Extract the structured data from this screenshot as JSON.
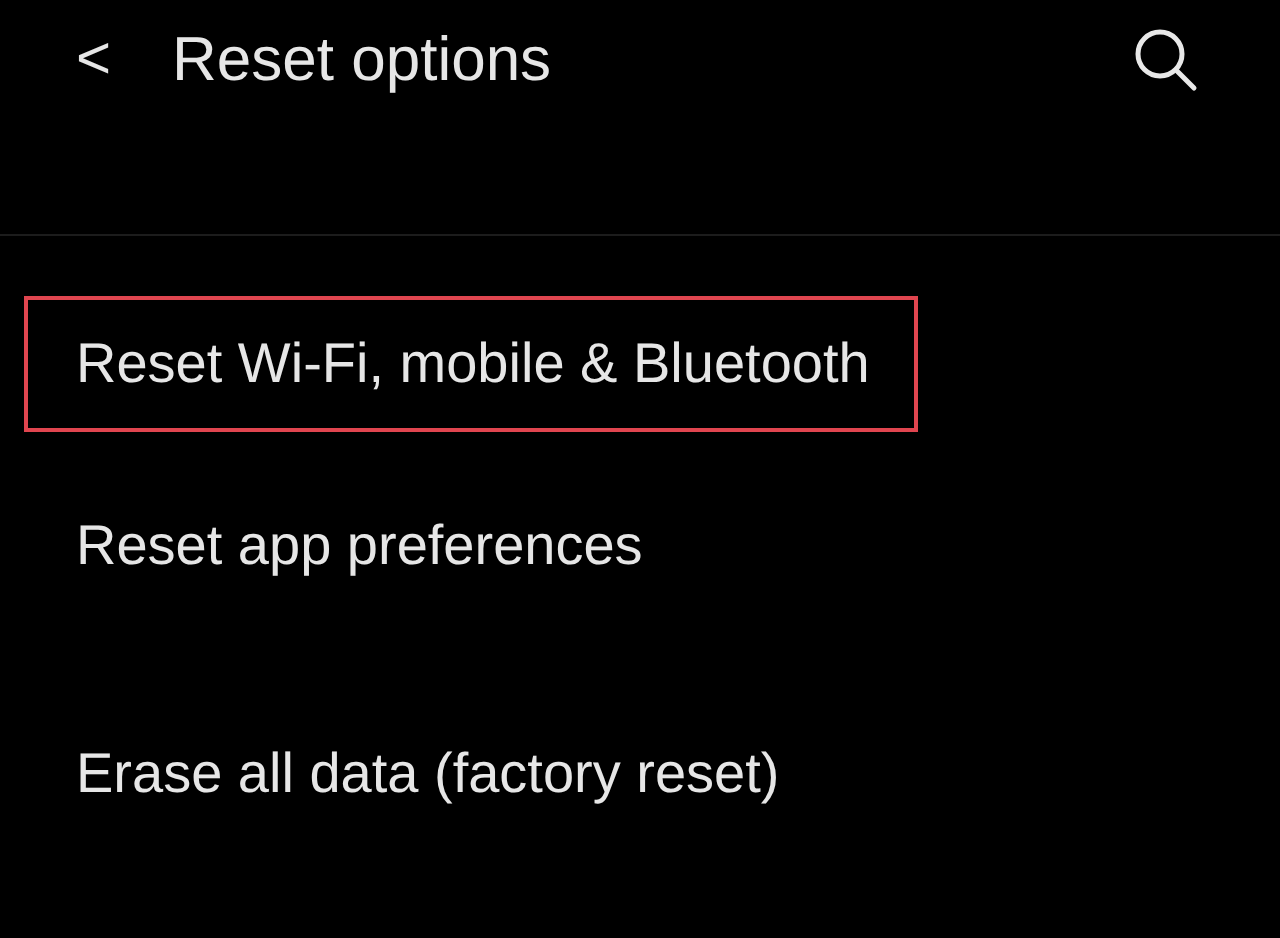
{
  "header": {
    "back_icon": "<",
    "title": "Reset options"
  },
  "items": [
    {
      "label": "Reset Wi-Fi, mobile & Bluetooth",
      "highlighted": true
    },
    {
      "label": "Reset app preferences",
      "highlighted": false
    },
    {
      "label": "Erase all data (factory reset)",
      "highlighted": false
    }
  ]
}
